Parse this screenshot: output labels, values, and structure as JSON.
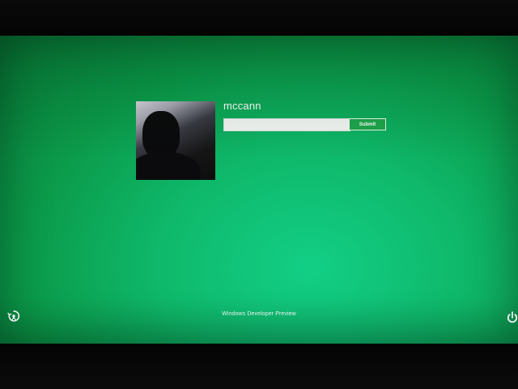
{
  "login": {
    "username": "mccann",
    "password_placeholder": "",
    "submit_label": "Submit"
  },
  "footer": {
    "brand": "Windows Developer Preview",
    "ease_of_access_icon": "ease-of-access-icon",
    "power_icon": "power-icon"
  },
  "colors": {
    "background": "#0fb86a",
    "accent_button": "#1ea54b"
  }
}
